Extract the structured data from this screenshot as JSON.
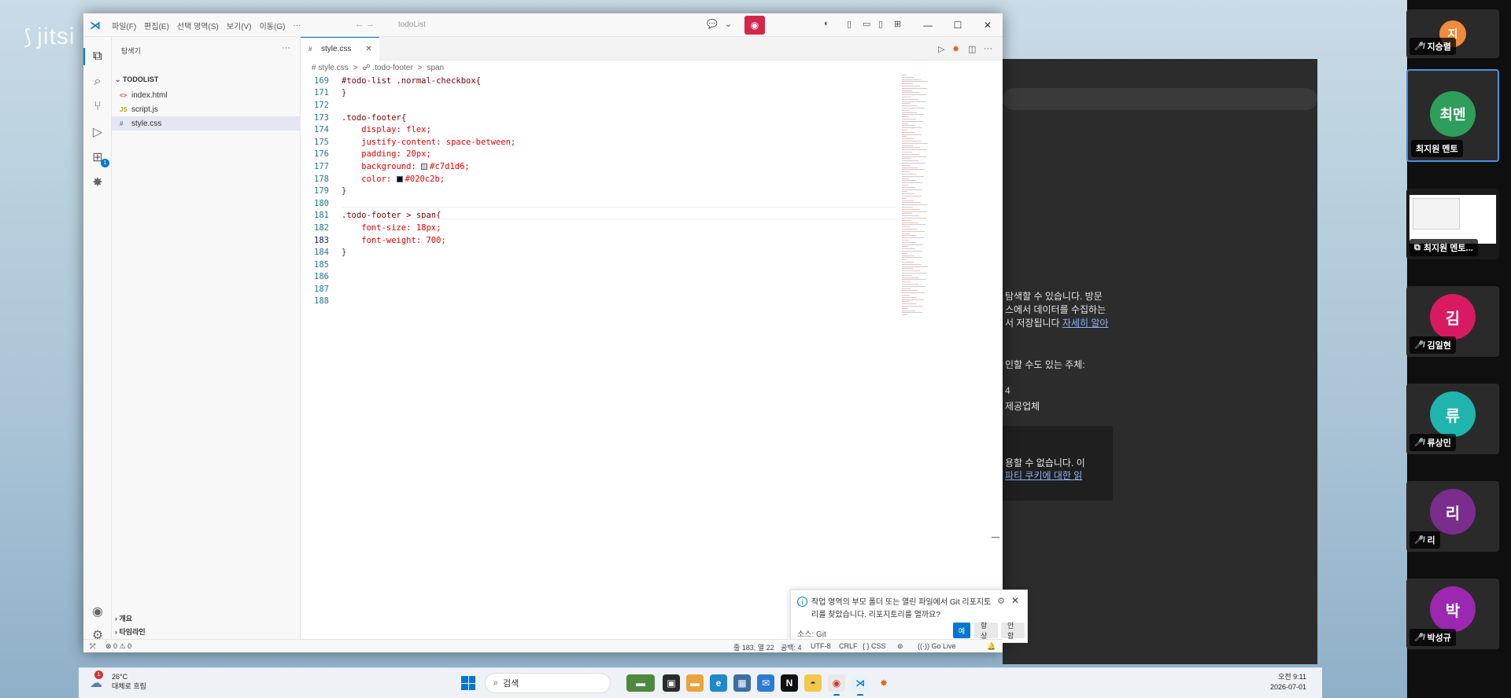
{
  "jitsi": {
    "logo": "jitsi",
    "bg_texts": [
      "탐색할 수 있습니다. 방문",
      "스에서 데이터를 수집하는",
      "서 저장됩니다",
      "자세히 알아",
      "인할 수도 있는 주체:",
      "4",
      "제공업체",
      "용할 수 없습니다. 이",
      "파티 쿠키에 대한 읽"
    ],
    "participants": [
      {
        "initial": "지",
        "name": "지승렬",
        "color": "#f08a3c"
      },
      {
        "initial": "최멘",
        "name": "최지원 멘토",
        "color": "#2e9e5b"
      },
      {
        "name": "최지원 멘토..."
      },
      {
        "initial": "김",
        "name": "김일현",
        "color": "#d81b60"
      },
      {
        "initial": "류",
        "name": "류상민",
        "color": "#1fb5ac"
      },
      {
        "initial": "리",
        "name": "리",
        "color": "#7b2d8e"
      },
      {
        "initial": "박",
        "name": "박성규",
        "color": "#9c27b0"
      }
    ]
  },
  "vscode": {
    "menu": [
      "파일(F)",
      "편집(E)",
      "선택 영역(S)",
      "보기(V)",
      "이동(G)",
      "···"
    ],
    "nav": "←  →",
    "search_placeholder": "todoList",
    "window_controls": [
      "—",
      "☐",
      "✕"
    ],
    "sidebar": {
      "title": "탐색기",
      "more": "···",
      "folder": "TODOLIST",
      "files": [
        {
          "name": "index.html",
          "icon": "<>"
        },
        {
          "name": "script.js",
          "icon": "JS"
        },
        {
          "name": "style.css",
          "icon": "#",
          "selected": true
        }
      ],
      "outline": "개요",
      "timeline": "타임라인"
    },
    "tab": {
      "label": "style.css",
      "icon": "#",
      "close": "✕"
    },
    "breadcrumb": [
      "# style.css",
      ">",
      "☍ .todo-footer",
      ">",
      "span"
    ],
    "code_lines": [
      {
        "n": "169",
        "t": "#todo-list .normal-checkbox{"
      },
      {
        "n": "171",
        "t": "}"
      },
      {
        "n": "172",
        "t": ""
      },
      {
        "n": "173",
        "t": ".todo-footer{"
      },
      {
        "n": "174",
        "t": "    display: flex;"
      },
      {
        "n": "175",
        "t": "    justify-content: space-between;"
      },
      {
        "n": "176",
        "t": "    padding: 20px;"
      },
      {
        "n": "177",
        "t": "    background: #c7d1d6;"
      },
      {
        "n": "178",
        "t": "    color: #020c2b;"
      },
      {
        "n": "179",
        "t": "}"
      },
      {
        "n": "180",
        "t": ""
      },
      {
        "n": "181",
        "t": ".todo-footer > span{"
      },
      {
        "n": "182",
        "t": "    font-size: 18px;"
      },
      {
        "n": "183",
        "t": "    font-weight: 700;"
      },
      {
        "n": "184",
        "t": "}"
      },
      {
        "n": "185",
        "t": ""
      },
      {
        "n": "186",
        "t": ""
      },
      {
        "n": "187",
        "t": ""
      },
      {
        "n": "188",
        "t": ""
      }
    ],
    "colors": {
      "swatch_bg": "#c7d1d6",
      "swatch_color": "#020c2b",
      "accent": "#0078d4",
      "record": "#d4264b"
    },
    "git_toast": {
      "message": "작업 영역의 부모 폴더 또는 열린 파일에서 Git 리포지토리를 찾았습니다. 리포지토리를 열까요?",
      "source": "소스: Git",
      "yes": "예",
      "always": "항상",
      "never": "안 함"
    },
    "status": {
      "errors": "⊗ 0 ⚠ 0",
      "position": "줄 183, 열 22",
      "spaces": "공백: 4",
      "encoding": "UTF-8",
      "eol": "CRLF",
      "language": "{ } CSS",
      "golive": "Go Live"
    }
  },
  "taskbar": {
    "weather_temp": "26°C",
    "weather_desc": "대체로 흐림",
    "weather_badge": "1",
    "search": "검색",
    "time": "오전 9:11",
    "date": "2026-07-01"
  }
}
